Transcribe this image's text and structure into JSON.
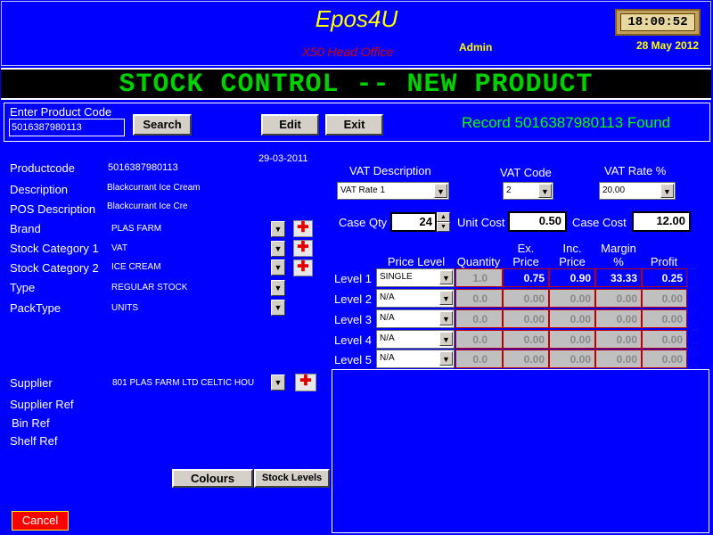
{
  "header": {
    "app_title": "Epos4U",
    "subtitle": "X50 Head Office",
    "user": "Admin",
    "clock": "18:00:52",
    "date": "28 May 2012"
  },
  "banner": {
    "text": "STOCK CONTROL -- NEW PRODUCT"
  },
  "toolbar": {
    "product_code_label": "Enter Product Code",
    "product_code_value": "5016387980113",
    "search_label": "Search",
    "edit_label": "Edit",
    "exit_label": "Exit",
    "status_message": "Record 5016387980113 Found"
  },
  "details": {
    "date": "29-03-2011",
    "productcode_label": "Productcode",
    "productcode_value": "5016387980113",
    "description_label": "Description",
    "description_value": "Blackcurrant Ice Cream",
    "pos_description_label": "POS Description",
    "pos_description_value": "Blackcurrant Ice Cre",
    "brand_label": "Brand",
    "brand_value": "PLAS FARM",
    "stock_cat1_label": "Stock Category 1",
    "stock_cat1_value": "VAT",
    "stock_cat2_label": "Stock Category 2",
    "stock_cat2_value": "ICE CREAM",
    "type_label": "Type",
    "type_value": "REGULAR STOCK",
    "packtype_label": "PackType",
    "packtype_value": "UNITS",
    "supplier_label": "Supplier",
    "supplier_value": "801   PLAS FARM LTD CELTIC HOU",
    "supplier_ref_label": "Supplier Ref",
    "bin_ref_label": "Bin Ref",
    "shelf_ref_label": "Shelf Ref"
  },
  "vat": {
    "description_label": "VAT Description",
    "description_value": "VAT Rate 1",
    "code_label": "VAT Code",
    "code_value": "2",
    "rate_label": "VAT Rate %",
    "rate_value": "20.00"
  },
  "costs": {
    "case_qty_label": "Case Qty",
    "case_qty_value": "24",
    "unit_cost_label": "Unit Cost",
    "unit_cost_value": "0.50",
    "case_cost_label": "Case Cost",
    "case_cost_value": "12.00"
  },
  "pricing": {
    "headers": {
      "price_level": "Price Level",
      "quantity": "Quantity",
      "ex_price_1": "Ex.",
      "ex_price_2": "Price",
      "inc_price_1": "Inc.",
      "inc_price_2": "Price",
      "margin_1": "Margin",
      "margin_2": "%",
      "profit": "Profit"
    },
    "rows": [
      {
        "label": "Level 1",
        "level": "SINGLE",
        "quantity": "1.0",
        "ex_price": "0.75",
        "inc_price": "0.90",
        "margin": "33.33",
        "profit": "0.25"
      },
      {
        "label": "Level 2",
        "level": "N/A",
        "quantity": "0.0",
        "ex_price": "0.00",
        "inc_price": "0.00",
        "margin": "0.00",
        "profit": "0.00"
      },
      {
        "label": "Level 3",
        "level": "N/A",
        "quantity": "0.0",
        "ex_price": "0.00",
        "inc_price": "0.00",
        "margin": "0.00",
        "profit": "0.00"
      },
      {
        "label": "Level 4",
        "level": "N/A",
        "quantity": "0.0",
        "ex_price": "0.00",
        "inc_price": "0.00",
        "margin": "0.00",
        "profit": "0.00"
      },
      {
        "label": "Level 5",
        "level": "N/A",
        "quantity": "0.0",
        "ex_price": "0.00",
        "inc_price": "0.00",
        "margin": "0.00",
        "profit": "0.00"
      }
    ]
  },
  "buttons": {
    "colours_label": "Colours",
    "stock_levels_label": "Stock Levels",
    "cancel_label": "Cancel"
  },
  "colors": {
    "background": "#0000ff",
    "title_yellow": "#ffff00",
    "banner_green": "#00d000",
    "status_green": "#00ff00",
    "grid_red": "#c00000",
    "cancel_red": "#ff0000"
  }
}
